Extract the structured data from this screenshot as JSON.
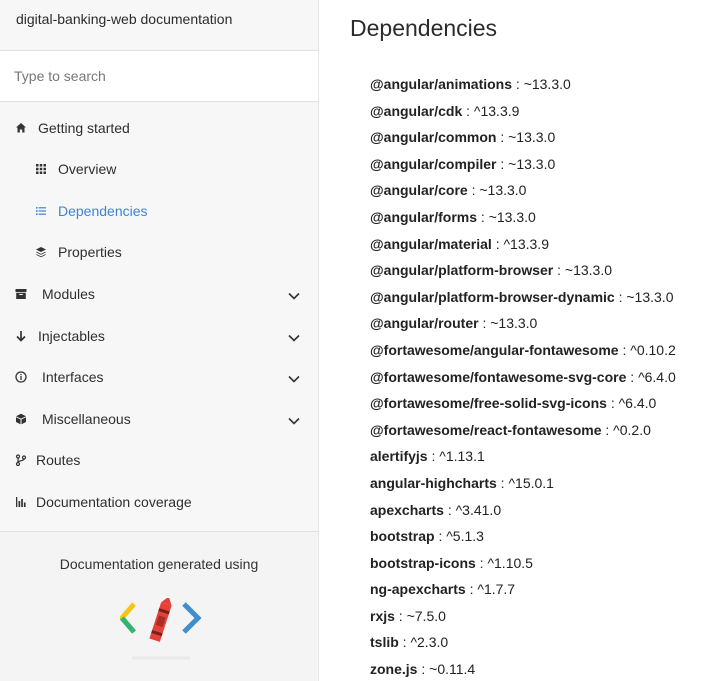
{
  "sidebar": {
    "brand": "digital-banking-web documentation",
    "search": {
      "placeholder": "Type to search",
      "value": ""
    },
    "items": [
      {
        "label": "Getting started",
        "icon": "home-icon"
      },
      {
        "label": "Overview",
        "icon": "grid-icon"
      },
      {
        "label": "Dependencies",
        "icon": "list-icon",
        "active": true
      },
      {
        "label": "Properties",
        "icon": "layers-icon"
      },
      {
        "label": "Modules",
        "icon": "archive-icon"
      },
      {
        "label": "Injectables",
        "icon": "arrow-down-icon"
      },
      {
        "label": "Interfaces",
        "icon": "info-icon"
      },
      {
        "label": "Miscellaneous",
        "icon": "cube-icon"
      },
      {
        "label": "Routes",
        "icon": "route-icon"
      },
      {
        "label": "Documentation coverage",
        "icon": "bar-chart-icon"
      }
    ],
    "footer": {
      "text": "Documentation generated using",
      "logo": "compodoc-logo"
    }
  },
  "main": {
    "title": "Dependencies",
    "deps": [
      {
        "name": "@angular/animations",
        "version": "~13.3.0"
      },
      {
        "name": "@angular/cdk",
        "version": "^13.3.9"
      },
      {
        "name": "@angular/common",
        "version": "~13.3.0"
      },
      {
        "name": "@angular/compiler",
        "version": "~13.3.0"
      },
      {
        "name": "@angular/core",
        "version": "~13.3.0"
      },
      {
        "name": "@angular/forms",
        "version": "~13.3.0"
      },
      {
        "name": "@angular/material",
        "version": "^13.3.9"
      },
      {
        "name": "@angular/platform-browser",
        "version": "~13.3.0"
      },
      {
        "name": "@angular/platform-browser-dynamic",
        "version": "~13.3.0"
      },
      {
        "name": "@angular/router",
        "version": "~13.3.0"
      },
      {
        "name": "@fortawesome/angular-fontawesome",
        "version": "^0.10.2"
      },
      {
        "name": "@fortawesome/fontawesome-svg-core",
        "version": "^6.4.0"
      },
      {
        "name": "@fortawesome/free-solid-svg-icons",
        "version": "^6.4.0"
      },
      {
        "name": "@fortawesome/react-fontawesome",
        "version": "^0.2.0"
      },
      {
        "name": "alertifyjs",
        "version": "^1.13.1"
      },
      {
        "name": "angular-highcharts",
        "version": "^15.0.1"
      },
      {
        "name": "apexcharts",
        "version": "^3.41.0"
      },
      {
        "name": "bootstrap",
        "version": "^5.1.3"
      },
      {
        "name": "bootstrap-icons",
        "version": "^1.10.5"
      },
      {
        "name": "ng-apexcharts",
        "version": "^1.7.7"
      },
      {
        "name": "rxjs",
        "version": "~7.5.0"
      },
      {
        "name": "tslib",
        "version": "^2.3.0"
      },
      {
        "name": "zone.js",
        "version": "~0.11.4"
      }
    ]
  },
  "colors": {
    "accent": "#3e84d6",
    "sidebar_bg": "#f7f7f7"
  }
}
